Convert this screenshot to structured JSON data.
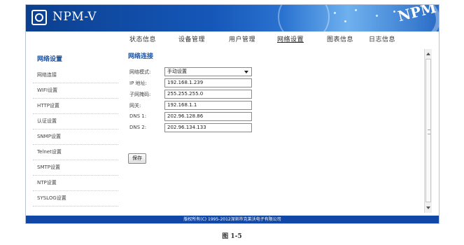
{
  "banner": {
    "brand": "NPM-V",
    "corner_text": "NPM"
  },
  "nav": {
    "items": [
      {
        "label": "状态信息",
        "active": false
      },
      {
        "label": "设备管理",
        "active": false
      },
      {
        "label": "用户管理",
        "active": false
      },
      {
        "label": "网络设置",
        "active": true
      },
      {
        "label": "图表信息",
        "active": false
      },
      {
        "label": "日志信息",
        "active": false
      }
    ]
  },
  "sidebar": {
    "title": "网络设置",
    "items": [
      {
        "label": "网络连接"
      },
      {
        "label": "WIFI设置"
      },
      {
        "label": "HTTP设置"
      },
      {
        "label": "认证设置"
      },
      {
        "label": "SNMP设置"
      },
      {
        "label": "Telnet设置"
      },
      {
        "label": "SMTP设置"
      },
      {
        "label": "NTP设置"
      },
      {
        "label": "SYSLOG设置"
      }
    ]
  },
  "content": {
    "title": "网络连接",
    "fields": [
      {
        "label": "网络模式:",
        "value": "手动设置",
        "type": "select"
      },
      {
        "label": "IP 地址:",
        "value": "192.168.1.239",
        "type": "input"
      },
      {
        "label": "子网掩码:",
        "value": "255.255.255.0",
        "type": "input"
      },
      {
        "label": "网关:",
        "value": "192.168.1.1",
        "type": "input"
      },
      {
        "label": "DNS 1:",
        "value": "202.96.128.86",
        "type": "input"
      },
      {
        "label": "DNS 2:",
        "value": "202.96.134.133",
        "type": "input"
      }
    ],
    "save_label": "保存"
  },
  "footer": {
    "text": "版权所有(C) 1995-2012深圳市克莱沃电子有限公司"
  },
  "caption": "图 1-5",
  "colors": {
    "accent": "#1147a6",
    "section_title": "#1a4f9c"
  }
}
